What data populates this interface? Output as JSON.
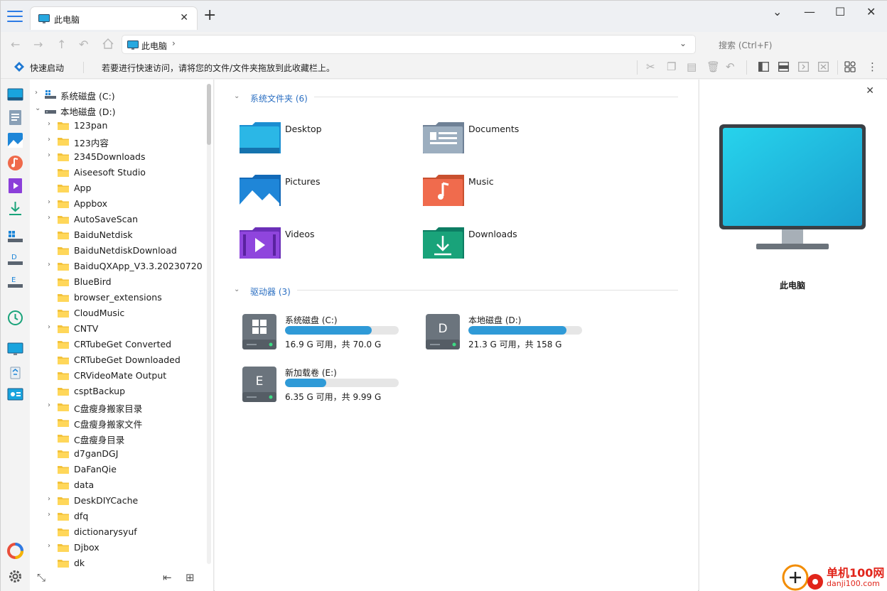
{
  "titlebar": {
    "tab_label": "此电脑",
    "tab_close": "✕",
    "new_tab": "+",
    "minimize": "—",
    "maximize": "☐",
    "close": "✕",
    "dropdown": "⌄"
  },
  "address": {
    "path": "此电脑",
    "chevron": "›",
    "history_dropdown": "⌄",
    "search_placeholder": "搜索 (Ctrl+F)"
  },
  "quick": {
    "label": "快速启动",
    "hint": "若要进行快速访问，请将您的文件/文件夹拖放到此收藏栏上。"
  },
  "tree": {
    "drives": [
      {
        "label": "系统磁盘 (C:)",
        "expanded": false
      },
      {
        "label": "本地磁盘 (D:)",
        "expanded": true
      }
    ],
    "folders": [
      {
        "label": "123pan",
        "has_children": true
      },
      {
        "label": "123内容",
        "has_children": true
      },
      {
        "label": "2345Downloads",
        "has_children": true
      },
      {
        "label": "Aiseesoft Studio",
        "has_children": false
      },
      {
        "label": "App",
        "has_children": false
      },
      {
        "label": "Appbox",
        "has_children": true
      },
      {
        "label": "AutoSaveScan",
        "has_children": true
      },
      {
        "label": "BaiduNetdisk",
        "has_children": false
      },
      {
        "label": "BaiduNetdiskDownload",
        "has_children": false
      },
      {
        "label": "BaiduQXApp_V3.3.20230720",
        "has_children": true
      },
      {
        "label": "BlueBird",
        "has_children": false
      },
      {
        "label": "browser_extensions",
        "has_children": false
      },
      {
        "label": "CloudMusic",
        "has_children": false
      },
      {
        "label": "CNTV",
        "has_children": true
      },
      {
        "label": "CRTubeGet Converted",
        "has_children": false
      },
      {
        "label": "CRTubeGet Downloaded",
        "has_children": false
      },
      {
        "label": "CRVideoMate Output",
        "has_children": false
      },
      {
        "label": "csptBackup",
        "has_children": false
      },
      {
        "label": "C盘瘦身搬家目录",
        "has_children": true
      },
      {
        "label": "C盘瘦身搬家文件",
        "has_children": false
      },
      {
        "label": "C盘瘦身目录",
        "has_children": false
      },
      {
        "label": "d7ganDGJ",
        "has_children": false
      },
      {
        "label": "DaFanQie",
        "has_children": false
      },
      {
        "label": "data",
        "has_children": false
      },
      {
        "label": "DeskDIYCache",
        "has_children": true
      },
      {
        "label": "dfq",
        "has_children": true
      },
      {
        "label": "dictionarysyuf",
        "has_children": false
      },
      {
        "label": "Djbox",
        "has_children": true
      },
      {
        "label": "dk",
        "has_children": false
      }
    ]
  },
  "main": {
    "folders_section": "系统文件夹 (6)",
    "drives_section": "驱动器 (3)",
    "folders": [
      {
        "name": "Desktop",
        "icon": "desktop-folder-icon"
      },
      {
        "name": "Documents",
        "icon": "documents-folder-icon"
      },
      {
        "name": "Pictures",
        "icon": "pictures-folder-icon"
      },
      {
        "name": "Music",
        "icon": "music-folder-icon"
      },
      {
        "name": "Videos",
        "icon": "videos-folder-icon"
      },
      {
        "name": "Downloads",
        "icon": "downloads-folder-icon"
      }
    ],
    "drives": [
      {
        "name": "系统磁盘 (C:)",
        "letter": "",
        "free": "16.9 G 可用，共 70.0 G",
        "used_fraction": 0.76
      },
      {
        "name": "本地磁盘 (D:)",
        "letter": "D",
        "free": "21.3 G 可用，共 158 G",
        "used_fraction": 0.865
      },
      {
        "name": "新加载卷 (E:)",
        "letter": "E",
        "free": "6.35 G 可用，共 9.99 G",
        "used_fraction": 0.364
      }
    ]
  },
  "details": {
    "title": "此电脑",
    "close": "✕"
  },
  "watermark": {
    "line1": "单机100网",
    "line2": "danji100.com"
  },
  "colors": {
    "accent": "#2b6fc2",
    "bar_fill": "#2f9ad7",
    "watermark": "#e1251b"
  }
}
